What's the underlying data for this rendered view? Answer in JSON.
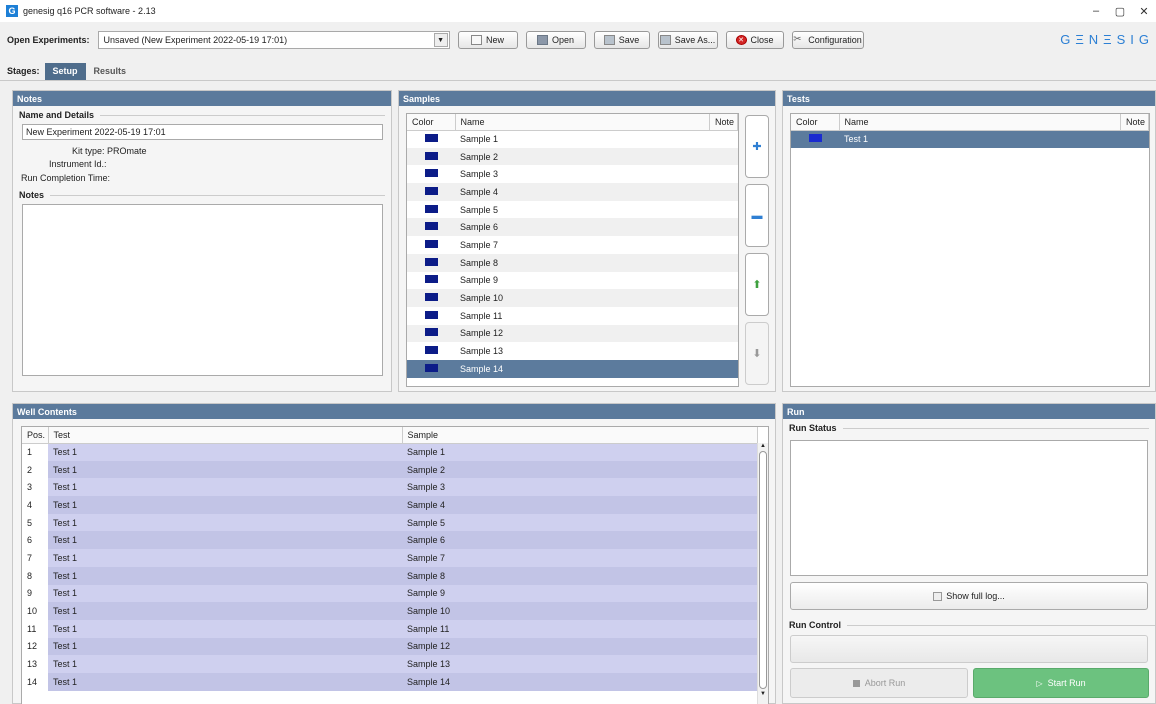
{
  "window": {
    "title": "genesig q16 PCR software - 2.13",
    "app_icon": "G",
    "minimize": "–",
    "restore": "▢",
    "close": "✕"
  },
  "toolbar": {
    "open_experiments_label": "Open Experiments:",
    "experiment_value": "Unsaved (New Experiment 2022-05-19 17:01)",
    "new_label": "New",
    "open_label": "Open",
    "save_label": "Save",
    "save_as_label": "Save As...",
    "close_label": "Close",
    "configuration_label": "Configuration",
    "logo": "GΞNΞSIG"
  },
  "stages": {
    "label": "Stages:",
    "tabs": [
      "Setup",
      "Results"
    ],
    "active": "Setup"
  },
  "notes_panel": {
    "title": "Notes",
    "name_details_heading": "Name and Details",
    "experiment_name": "New Experiment 2022-05-19 17:01",
    "kit_type_label": "Kit type:",
    "kit_type_value": "PROmate",
    "instrument_label": "Instrument Id.:",
    "instrument_value": "",
    "run_completion_label": "Run Completion Time:",
    "run_completion_value": "",
    "notes_heading": "Notes"
  },
  "samples_panel": {
    "title": "Samples",
    "columns": [
      "Color",
      "Name",
      "Note"
    ],
    "rows": [
      "Sample 1",
      "Sample 2",
      "Sample 3",
      "Sample 4",
      "Sample 5",
      "Sample 6",
      "Sample 7",
      "Sample 8",
      "Sample 9",
      "Sample 10",
      "Sample 11",
      "Sample 12",
      "Sample 13",
      "Sample 14"
    ],
    "selected": "Sample 14",
    "swatch_color": "#0c1c88"
  },
  "tests_panel": {
    "title": "Tests",
    "columns": [
      "Color",
      "Name",
      "Note"
    ],
    "rows": [
      "Test 1"
    ],
    "swatch_color": "#1a2bd0"
  },
  "well_panel": {
    "title": "Well Contents",
    "columns": [
      "Pos.",
      "Test",
      "Sample"
    ],
    "rows": [
      [
        "1",
        "Test 1",
        "Sample 1"
      ],
      [
        "2",
        "Test 1",
        "Sample 2"
      ],
      [
        "3",
        "Test 1",
        "Sample 3"
      ],
      [
        "4",
        "Test 1",
        "Sample 4"
      ],
      [
        "5",
        "Test 1",
        "Sample 5"
      ],
      [
        "6",
        "Test 1",
        "Sample 6"
      ],
      [
        "7",
        "Test 1",
        "Sample 7"
      ],
      [
        "8",
        "Test 1",
        "Sample 8"
      ],
      [
        "9",
        "Test 1",
        "Sample 9"
      ],
      [
        "10",
        "Test 1",
        "Sample 10"
      ],
      [
        "11",
        "Test 1",
        "Sample 11"
      ],
      [
        "12",
        "Test 1",
        "Sample 12"
      ],
      [
        "13",
        "Test 1",
        "Sample 13"
      ],
      [
        "14",
        "Test 1",
        "Sample 14"
      ]
    ]
  },
  "run_panel": {
    "title": "Run",
    "status_heading": "Run Status",
    "show_log_label": "Show full log...",
    "control_heading": "Run Control",
    "abort_label": "Abort Run",
    "start_label": "Start Run",
    "start_color": "#6cc27f"
  }
}
